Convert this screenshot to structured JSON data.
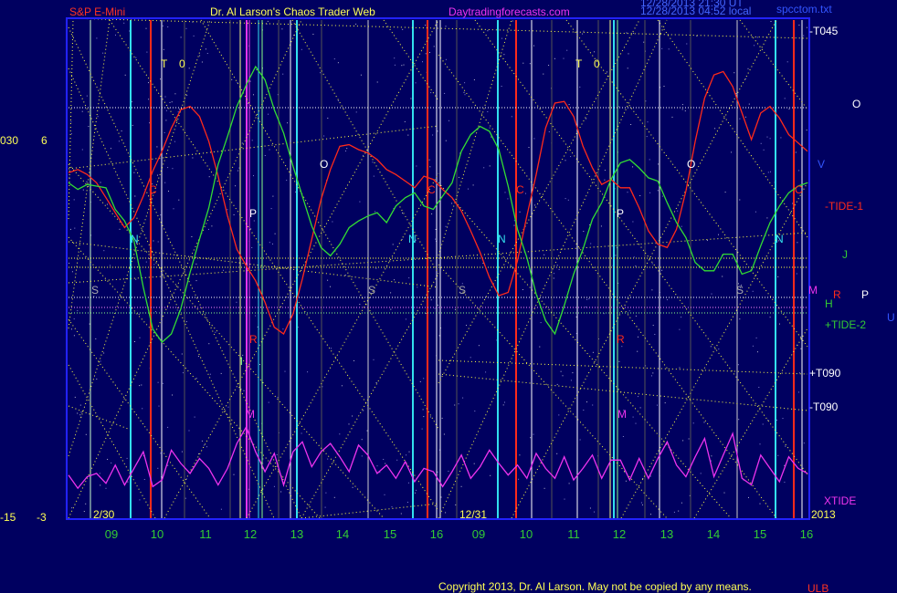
{
  "header": {
    "instrument": "S&P E-Mini",
    "site": "Dr. Al Larson's Chaos Trader Web",
    "url": "Daytradingforecasts.com",
    "stamp1": "12/28/2013 21:30 UT",
    "stamp2": "12/28/2013 04:52 local",
    "file": "spcctom.txt"
  },
  "footer": {
    "copyright": "Copyright 2013, Dr. Al Larson. May not be copied by any means.",
    "tag": "ULB"
  },
  "left_axis": {
    "top_a": "030",
    "top_b": "6",
    "bottom_a": "-15",
    "bottom_b": "-3"
  },
  "colors": {
    "background": "#000060",
    "frame": "#1111ff",
    "price": "#ff2a1a",
    "tide2": "#33dd33",
    "xtide": "#ee33ee",
    "yellow": "#ffff44",
    "cyan": "#33e0ee",
    "white": "#ffffff",
    "green_label": "#33cc33"
  },
  "chart_data": {
    "type": "line",
    "title": "S&P E-Mini",
    "x_axis": {
      "ticks": [
        "09",
        "10",
        "11",
        "12",
        "13",
        "14",
        "15",
        "16",
        "09",
        "10",
        "11",
        "12",
        "13",
        "14",
        "15",
        "16"
      ],
      "date_labels": [
        "2/30",
        "12/31"
      ],
      "year_label": "2013"
    },
    "y_axis_left": {
      "top": "030",
      "top_alt": "6",
      "bottom": "-15",
      "bottom_alt": "-3"
    },
    "series": [
      {
        "name": "-TIDE-1",
        "values": [
          5.8,
          6.0,
          5.7,
          5.2,
          4.3,
          3.4,
          2.5,
          3.1,
          4.4,
          5.9,
          7.1,
          8.5,
          9.6,
          9.8,
          9.2,
          7.7,
          5.6,
          3.2,
          1.2,
          0.2,
          -0.7,
          -2.0,
          -3.5,
          -3.9,
          -2.7,
          -0.6,
          1.8,
          4.2,
          6.0,
          7.4,
          7.5,
          7.2,
          7.0,
          6.6,
          6.0,
          5.7,
          5.3,
          4.9,
          5.6,
          5.4,
          4.8,
          4.3,
          3.5,
          2.3,
          1.0,
          -0.5,
          -1.6,
          -1.4,
          0.5,
          3.2,
          5.7,
          8.5,
          10.0,
          10.1,
          9.2,
          7.4,
          6.1,
          5.1,
          5.4,
          4.9,
          4.9,
          3.7,
          2.3,
          1.5,
          1.3,
          2.4,
          4.7,
          7.7,
          10.3,
          11.7,
          11.9,
          11.0,
          9.4,
          7.8,
          9.4,
          9.8,
          9.1,
          8.1,
          7.6,
          7.1
        ]
      },
      {
        "name": "+TIDE-2",
        "values": [
          5.2,
          4.8,
          5.1,
          5.0,
          4.9,
          3.6,
          2.9,
          1.7,
          -1.1,
          -3.6,
          -4.4,
          -3.9,
          -2.4,
          -0.2,
          1.8,
          3.7,
          6.3,
          8.0,
          9.8,
          11.1,
          12.2,
          11.4,
          9.6,
          8.2,
          6.2,
          4.4,
          2.6,
          1.3,
          0.8,
          1.5,
          2.5,
          2.9,
          3.2,
          3.4,
          2.8,
          3.8,
          4.3,
          4.6,
          3.8,
          3.6,
          4.4,
          5.2,
          7.1,
          8.1,
          8.6,
          8.3,
          7.2,
          5.0,
          2.4,
          0.7,
          -1.5,
          -3.1,
          -3.9,
          -2.2,
          -0.3,
          1.2,
          3.0,
          4.0,
          5.4,
          6.4,
          6.6,
          6.1,
          5.5,
          5.3,
          4.0,
          2.8,
          1.9,
          0.4,
          -0.1,
          -0.1,
          0.9,
          0.9,
          -0.3,
          -0.1,
          1.4,
          2.8,
          3.8,
          4.6,
          5.0,
          5.2
        ]
      },
      {
        "name": "XTIDE",
        "values": [
          -12.4,
          -13.2,
          -12.5,
          -12.3,
          -12.9,
          -11.8,
          -13.0,
          -12.0,
          -11.0,
          -13.1,
          -12.7,
          -10.9,
          -11.7,
          -12.3,
          -11.4,
          -12.0,
          -13.0,
          -12.0,
          -10.5,
          -9.5,
          -11.0,
          -12.2,
          -11.1,
          -13.0,
          -11.0,
          -10.4,
          -11.9,
          -11.0,
          -10.5,
          -11.3,
          -12.2,
          -10.6,
          -11.2,
          -12.3,
          -11.8,
          -12.6,
          -11.6,
          -12.8,
          -12.0,
          -12.2,
          -13.1,
          -12.2,
          -11.2,
          -12.6,
          -11.9,
          -10.9,
          -11.7,
          -12.4,
          -11.8,
          -12.6,
          -11.1,
          -12.0,
          -12.6,
          -11.3,
          -12.7,
          -12.0,
          -11.2,
          -12.6,
          -11.5,
          -11.5,
          -12.7,
          -11.4,
          -12.6,
          -11.4,
          -10.4,
          -11.8,
          -12.5,
          -11.3,
          -10.2,
          -12.5,
          -11.2,
          -9.9,
          -12.6,
          -13.0,
          -11.2,
          -12.0,
          -12.8,
          -11.3,
          -12.0,
          -12.3
        ]
      }
    ],
    "level_labels": [
      "-T045",
      "O",
      "V",
      "-TIDE-1",
      "J",
      "M",
      "R",
      "P",
      "H",
      "U",
      "+TIDE-2",
      "+T090",
      "-T090",
      "XTIDE"
    ],
    "letter_marks": [
      "T",
      "0",
      "C",
      "N",
      "P",
      "S",
      "R",
      "M",
      "O",
      "C",
      "N",
      "S",
      "T",
      "0",
      "C",
      "N",
      "P",
      "S",
      "R",
      "M",
      "O",
      "C",
      "N",
      "S",
      "t",
      "l"
    ],
    "ylim": [
      -15,
      15
    ],
    "grid": true
  }
}
